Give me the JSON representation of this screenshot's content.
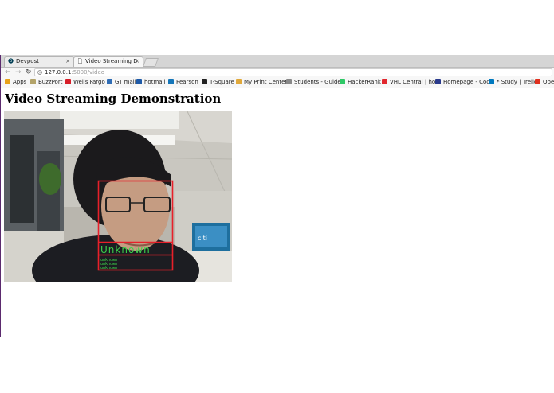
{
  "tabs": [
    {
      "title": "Devpost",
      "icon": "devpost-icon",
      "active": false
    },
    {
      "title": "Video Streaming D",
      "icon": "page-icon",
      "active": true
    }
  ],
  "toolbar": {
    "back": "←",
    "forward": "→",
    "reload": "↻",
    "url_host": "127.0.0.1",
    "url_path": ":5000/video"
  },
  "bookmarks": [
    {
      "label": "Apps",
      "icon": "apps-icon",
      "color": "#e8a21a"
    },
    {
      "label": "BuzzPort",
      "icon": "buzzport-icon",
      "color": "#b3a369"
    },
    {
      "label": "Wells Fargo",
      "icon": "wellsfargo-icon",
      "color": "#d71e28"
    },
    {
      "label": "GT mail",
      "icon": "gtmail-icon",
      "color": "#2f6db5"
    },
    {
      "label": "hotmail",
      "icon": "hotmail-icon",
      "color": "#1e5aa8"
    },
    {
      "label": "Pearson",
      "icon": "pearson-icon",
      "color": "#1576b9"
    },
    {
      "label": "T-Square",
      "icon": "tsquare-icon",
      "color": "#222222"
    },
    {
      "label": "My Print Center",
      "icon": "print-icon",
      "color": "#e0a83a"
    },
    {
      "label": "Students - Guide",
      "icon": "google-icon",
      "color": "#888888"
    },
    {
      "label": "HackerRank",
      "icon": "hackerrank-icon",
      "color": "#2ec866"
    },
    {
      "label": "VHL Central | ho",
      "icon": "vhl-icon",
      "color": "#e1262d"
    },
    {
      "label": "Homepage - Coc",
      "icon": "homepage-icon",
      "color": "#2a3a8c"
    },
    {
      "label": "* Study | Trello",
      "icon": "trello-icon",
      "color": "#0079bf"
    },
    {
      "label": "Ope",
      "icon": "opera-icon",
      "color": "#e0301e"
    }
  ],
  "page": {
    "title": "Video Streaming Demonstration",
    "video": {
      "face_label": "Unknown",
      "log_lines": [
        "unknown",
        "unknown",
        "unknown"
      ],
      "box_color": "#e8202a",
      "label_color": "#3cd24a"
    }
  }
}
